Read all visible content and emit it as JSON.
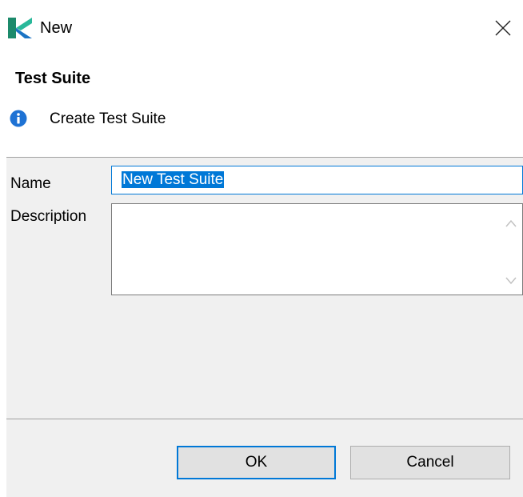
{
  "window": {
    "title": "New",
    "logo_icon": "katalon-logo",
    "close_icon": "close-icon"
  },
  "header": {
    "title": "Test Suite",
    "message": "Create Test Suite",
    "message_icon": "info-icon"
  },
  "form": {
    "name_label": "Name",
    "name_value": "New Test Suite",
    "description_label": "Description",
    "description_value": ""
  },
  "footer": {
    "ok_label": "OK",
    "cancel_label": "Cancel"
  },
  "colors": {
    "accent": "#0078d7",
    "info": "#1e72d4",
    "panel_bg": "#f0f0f0",
    "button_bg": "#e1e1e1"
  }
}
